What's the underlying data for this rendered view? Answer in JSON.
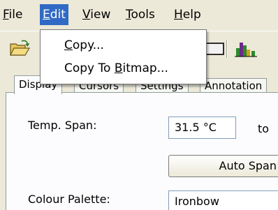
{
  "menubar": {
    "file": {
      "label": "File",
      "accel": "F",
      "rest": "ile"
    },
    "edit": {
      "label": "Edit",
      "accel": "E",
      "rest": "dit"
    },
    "view": {
      "label": "View",
      "accel": "V",
      "rest": "iew"
    },
    "tools": {
      "label": "Tools",
      "accel": "T",
      "rest": "ools"
    },
    "help": {
      "label": "Help",
      "accel": "H",
      "rest": "elp"
    }
  },
  "edit_menu": {
    "copy": {
      "pre": "",
      "accel": "C",
      "post": "opy..."
    },
    "copy_to_bitmap": {
      "pre": "Copy To ",
      "accel": "B",
      "post": "itmap..."
    }
  },
  "toolbar": {
    "open_icon": "open-folder-icon",
    "palette_icon": "palette-icon"
  },
  "tabs": [
    "Display",
    "Cursors",
    "Settings",
    "Annotation"
  ],
  "display": {
    "temp_span_label": "Temp. Span:",
    "temp_span_value": "31.5 °C",
    "to_label": "to",
    "auto_span_label": "Auto Span",
    "colour_palette_label": "Colour Palette:",
    "colour_palette_value": "Ironbow"
  },
  "colors": {
    "menu_highlight": "#316ac5",
    "background": "#ece9d8"
  }
}
